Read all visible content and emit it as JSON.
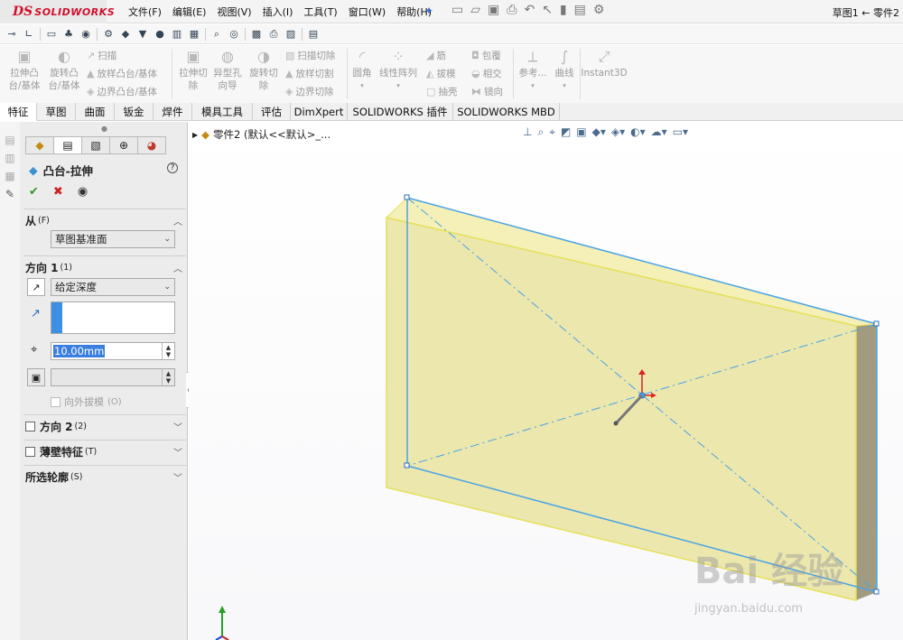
{
  "titlebar": {
    "brand": "SOLIDWORKS",
    "brand_mark": "DS",
    "menus": [
      "文件(F)",
      "编辑(E)",
      "视图(V)",
      "插入(I)",
      "工具(T)",
      "窗口(W)",
      "帮助(H)"
    ],
    "window_title": "草图1 ← 零件2"
  },
  "ribbon": {
    "extrude_boss": "拉伸凸\n台/基体",
    "revolve_boss": "旋转凸\n台/基体",
    "sweep": "扫描",
    "loft": "放样凸台/基体",
    "boundary": "边界凸台/基体",
    "extrude_cut": "拉伸切\n除",
    "hole_wizard": "异型孔\n向导",
    "revolve_cut": "旋转切\n除",
    "swept_cut": "扫描切除",
    "lofted_cut": "放样切割",
    "boundary_cut": "边界切除",
    "fillet": "圆角",
    "linear_pattern": "线性阵列",
    "rib": "筋",
    "draft": "拔模",
    "shell": "抽壳",
    "wrap": "包覆",
    "intersect": "相交",
    "mirror": "镜向",
    "reference": "参考...",
    "curves": "曲线",
    "instant3d": "Instant3D"
  },
  "tabs": [
    "特征",
    "草图",
    "曲面",
    "钣金",
    "焊件",
    "模具工具",
    "评估",
    "DimXpert",
    "SOLIDWORKS 插件",
    "SOLIDWORKS MBD"
  ],
  "pm": {
    "title": "凸台-拉伸",
    "from_label": "从",
    "from_key": "(F)",
    "from_value": "草图基准面",
    "dir1_label": "方向 1",
    "dir1_key": "(1)",
    "end_condition": "给定深度",
    "depth": "10.00mm",
    "draft_outward": "向外拔模",
    "draft_outward_key": "(O)",
    "dir2_label": "方向 2",
    "dir2_key": "(2)",
    "thin_label": "薄壁特征",
    "thin_key": "(T)",
    "contours_label": "所选轮廓",
    "contours_key": "(S)"
  },
  "viewport": {
    "tree_label": "零件2 (默认<<默认>_...",
    "watermark": "Bai  经验",
    "watermark_url": "jingyan.baidu.com"
  },
  "colors": {
    "accent_blue": "#3d8fe6",
    "model_face": "#ebe7ad",
    "model_top": "#f4f0b8",
    "model_side": "#a19c80",
    "sketch_line": "#4aa3e6",
    "brand_red": "#d0102b"
  }
}
